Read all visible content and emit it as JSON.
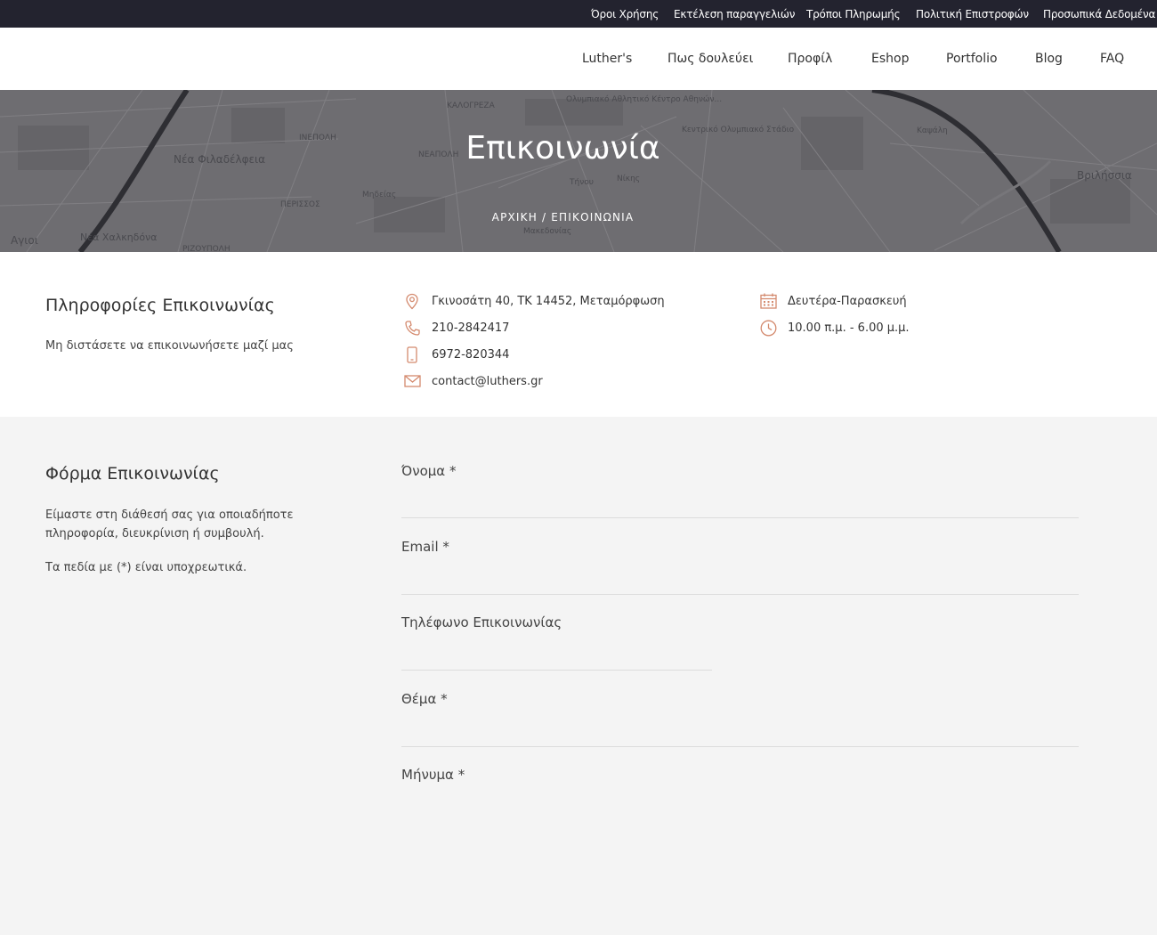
{
  "topbar": {
    "links": [
      "Όροι Χρήσης",
      "Εκτέλεση παραγγελιών",
      "Τρόποι Πληρωμής",
      "Πολιτική Επιστροφών",
      "Προσωπικά Δεδομένα"
    ]
  },
  "nav": {
    "items": [
      "Luther's",
      "Πως δουλεύει",
      "Προφίλ",
      "Eshop",
      "Portfolio",
      "Blog",
      "FAQ"
    ]
  },
  "hero": {
    "title": "Επικοινωνία",
    "breadcrumb_home": "ΑΡΧΙΚΗ",
    "breadcrumb_sep": "/",
    "breadcrumb_current": "ΕΠΙΚΟΙΝΩΝΙΑ",
    "map_labels": [
      "Νέα Φιλαδέλφεια",
      "Αγιοι",
      "Νέα Χαλκηδόνα",
      "ΙΝΕΠΟΛΗ",
      "ΚΑΛΟΓΡΕΖΑ",
      "ΝΕΑΠΟΛΗ",
      "ΠΕΡΙΣΣΟΣ",
      "ΡΙΖΟΥΠΟΛΗ",
      "Ολυμπιακό Αθλητικό Κέντρο Αθηνών...",
      "Κεντρικό Ολυμπιακό Στάδιο",
      "Βριλήσσια",
      "Μηδείας",
      "Τήνου",
      "Νίκης",
      "Καψάλη",
      "Μακεδονίας"
    ]
  },
  "info": {
    "title": "Πληροφορίες Επικοινωνίας",
    "subtitle": "Μη διστάσετε να επικοινωνήσετε μαζί μας",
    "address": "Γκινοσάτη 40, ΤΚ 14452, Μεταμόρφωση",
    "phone": "210-2842417",
    "mobile": "6972-820344",
    "email": "contact@luthers.gr",
    "days": "Δευτέρα-Παρασκευή",
    "hours": "10.00 π.μ. - 6.00 μ.μ.",
    "accent": "#d48a6e"
  },
  "form": {
    "title": "Φόρμα Επικοινωνίας",
    "text1": "Είμαστε στη διάθεσή σας για οποιαδήποτε πληροφορία, διευκρίνιση ή συμβουλή.",
    "text2": "Τα πεδία με (*) είναι υποχρεωτικά.",
    "name_label": "Όνομα *",
    "email_label": "Email *",
    "phone_label": "Τηλέφωνο Επικοινωνίας",
    "subject_label": "Θέμα *",
    "message_label": "Μήνυμα *",
    "name_value": "",
    "email_value": "",
    "phone_value": "",
    "subject_value": "",
    "message_value": ""
  }
}
